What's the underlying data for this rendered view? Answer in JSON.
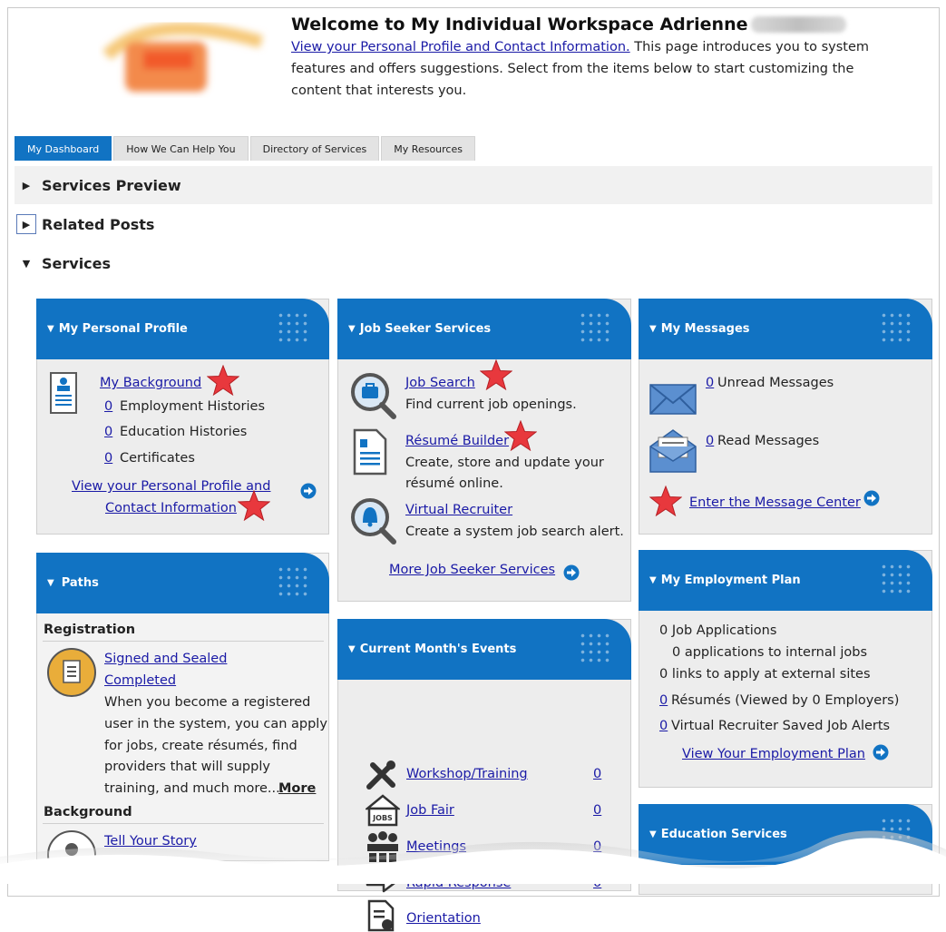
{
  "header": {
    "welcome": "Welcome to My Individual Workspace Adrienne",
    "profile_link": "View your Personal Profile and Contact Information.",
    "intro_rest": " This page introduces you to system features and offers suggestions. Select from the items below to start customizing the content that interests you."
  },
  "tabs": [
    {
      "label": "My Dashboard"
    },
    {
      "label": "How We Can Help You"
    },
    {
      "label": "Directory of Services"
    },
    {
      "label": "My Resources"
    }
  ],
  "sections": {
    "services_preview": "Services Preview",
    "related_posts": "Related Posts",
    "services": "Services"
  },
  "personal_profile": {
    "title": "My Personal Profile",
    "my_background": "My Background",
    "employment_count": "0",
    "employment_label": "Employment Histories",
    "education_count": "0",
    "education_label": "Education Histories",
    "certificates_count": "0",
    "certificates_label": "Certificates",
    "view_profile_line1": "View your Personal Profile and",
    "view_profile_line2": "Contact Information"
  },
  "paths": {
    "title": "Paths",
    "registration": "Registration",
    "signed_sealed": "Signed and Sealed",
    "completed": "Completed",
    "desc_lines": [
      "When you become a registered",
      "user in the system, you can apply",
      "for jobs, create résumés, find",
      "providers that will supply",
      "training, and much more...."
    ],
    "more": "More",
    "background": "Background",
    "tell_story": "Tell Your Story"
  },
  "job_seeker": {
    "title": "Job Seeker Services",
    "job_search": "Job Search",
    "job_search_desc": "Find current job openings.",
    "resume_builder": "Résumé Builder",
    "resume_desc_1": "Create, store and update your",
    "resume_desc_2": "résumé online.",
    "virtual_recruiter": "Virtual Recruiter",
    "virtual_desc": "Create a system job search alert.",
    "more": "More Job Seeker Services"
  },
  "events": {
    "title": "Current Month's Events",
    "items": [
      {
        "label": "Workshop/Training",
        "count": "0"
      },
      {
        "label": "Job Fair",
        "count": "0"
      },
      {
        "label": "Meetings",
        "count": "0"
      },
      {
        "label": "Rapid Response",
        "count": "0"
      },
      {
        "label": "Orientation",
        "count": ""
      }
    ],
    "jobs_badge": "JOBS"
  },
  "messages": {
    "title": "My Messages",
    "unread_count": "0",
    "unread_label": "Unread Messages",
    "read_count": "0",
    "read_label": "Read Messages",
    "enter": "Enter the Message Center"
  },
  "employment_plan": {
    "title": "My Employment Plan",
    "job_applications": "0 Job Applications",
    "internal": "0 applications to internal jobs",
    "external": "0 links to apply at external sites",
    "resumes_count": "0",
    "resumes_label": "Résumés (Viewed by 0 Employers)",
    "alerts_count": "0",
    "alerts_label": "Virtual Recruiter Saved Job Alerts",
    "view_plan": "View Your Employment Plan"
  },
  "education": {
    "title": "Education Services"
  },
  "colors": {
    "accent": "#1173c3",
    "link": "#1a1aa6",
    "star": "#e8383d"
  }
}
